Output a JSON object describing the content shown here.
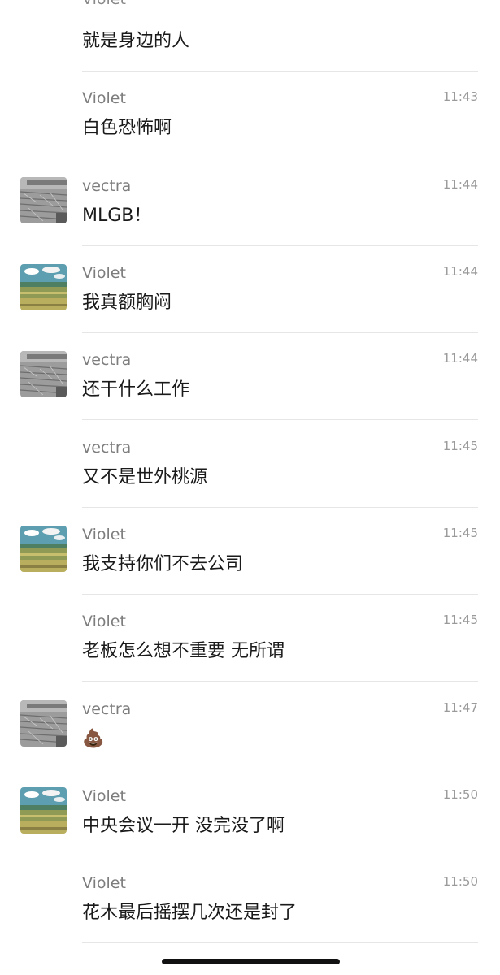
{
  "header": {
    "peek_sender": "Violet"
  },
  "messages": [
    {
      "sender": "",
      "time": "",
      "text": "就是身边的人",
      "avatar": "none"
    },
    {
      "sender": "Violet",
      "time": "11:43",
      "text": "白色恐怖啊",
      "avatar": "none"
    },
    {
      "sender": "vectra",
      "time": "11:44",
      "text": "MLGB！",
      "avatar": "vectra-avatar"
    },
    {
      "sender": "Violet",
      "time": "11:44",
      "text": "我真额胸闷",
      "avatar": "violet-avatar"
    },
    {
      "sender": "vectra",
      "time": "11:44",
      "text": "还干什么工作",
      "avatar": "vectra-avatar"
    },
    {
      "sender": "vectra",
      "time": "11:45",
      "text": "又不是世外桃源",
      "avatar": "none"
    },
    {
      "sender": "Violet",
      "time": "11:45",
      "text": "我支持你们不去公司",
      "avatar": "violet-avatar"
    },
    {
      "sender": "Violet",
      "time": "11:45",
      "text": "老板怎么想不重要 无所谓",
      "avatar": "none"
    },
    {
      "sender": "vectra",
      "time": "11:47",
      "text": "💩",
      "avatar": "vectra-avatar"
    },
    {
      "sender": "Violet",
      "time": "11:50",
      "text": "中央会议一开 没完没了啊",
      "avatar": "violet-avatar"
    },
    {
      "sender": "Violet",
      "time": "11:50",
      "text": "花木最后摇摆几次还是封了",
      "avatar": "none"
    }
  ]
}
